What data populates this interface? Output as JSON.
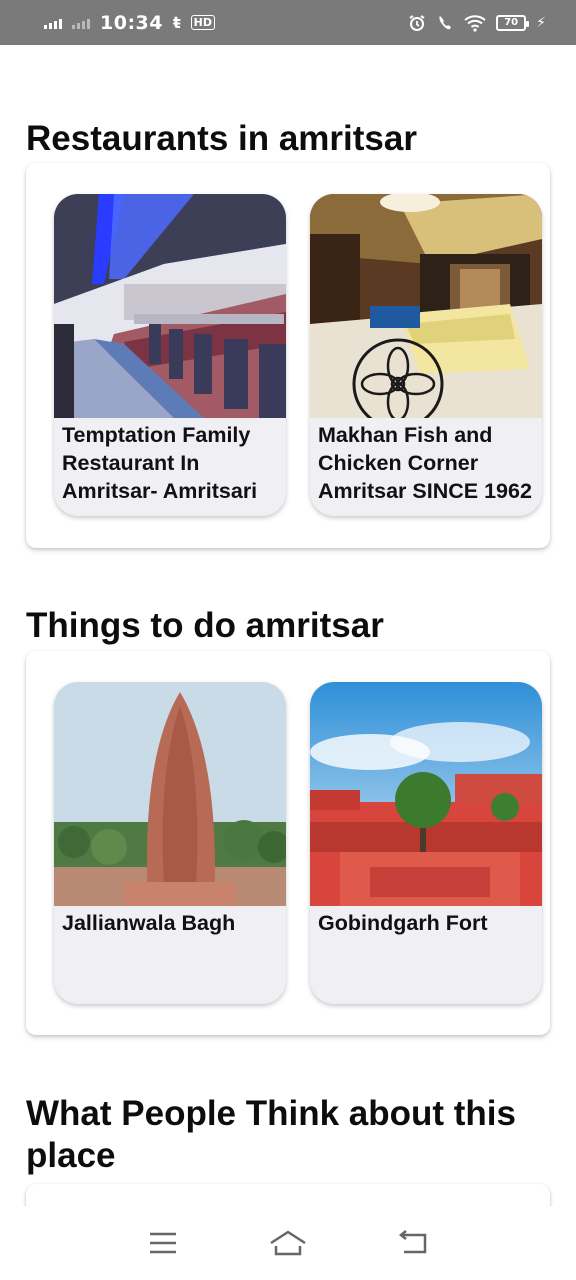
{
  "status_bar": {
    "time": "10:34",
    "carrier_glyph": "ŧ",
    "hd_glyph": "HD",
    "battery": "70",
    "icons": [
      "signal-icon",
      "signal-weak-icon",
      "alarm-icon",
      "wifi-calling-icon",
      "wifi-icon",
      "battery-icon",
      "charging-icon"
    ]
  },
  "sections": {
    "restaurants": {
      "title": "Restaurants in amritsar",
      "cards": [
        {
          "label": "Temptation Family Restaurant In Amritsar- Amritsari sizzlers- Best food",
          "image": "restaurant-interior-image"
        },
        {
          "label": "Makhan Fish and Chicken Corner Amritsar SINCE 1962",
          "image": "restaurant-lobby-image"
        }
      ]
    },
    "things_to_do": {
      "title": "Things to do amritsar",
      "cards": [
        {
          "label": "Jallianwala Bagh",
          "image": "jallianwala-bagh-memorial-image"
        },
        {
          "label": "Gobindgarh Fort",
          "image": "gobindgarh-fort-image"
        }
      ]
    },
    "reviews": {
      "title": "What People Think about this place"
    }
  },
  "nav_bar": {
    "icons": [
      "menu-icon",
      "home-icon",
      "back-icon"
    ]
  }
}
